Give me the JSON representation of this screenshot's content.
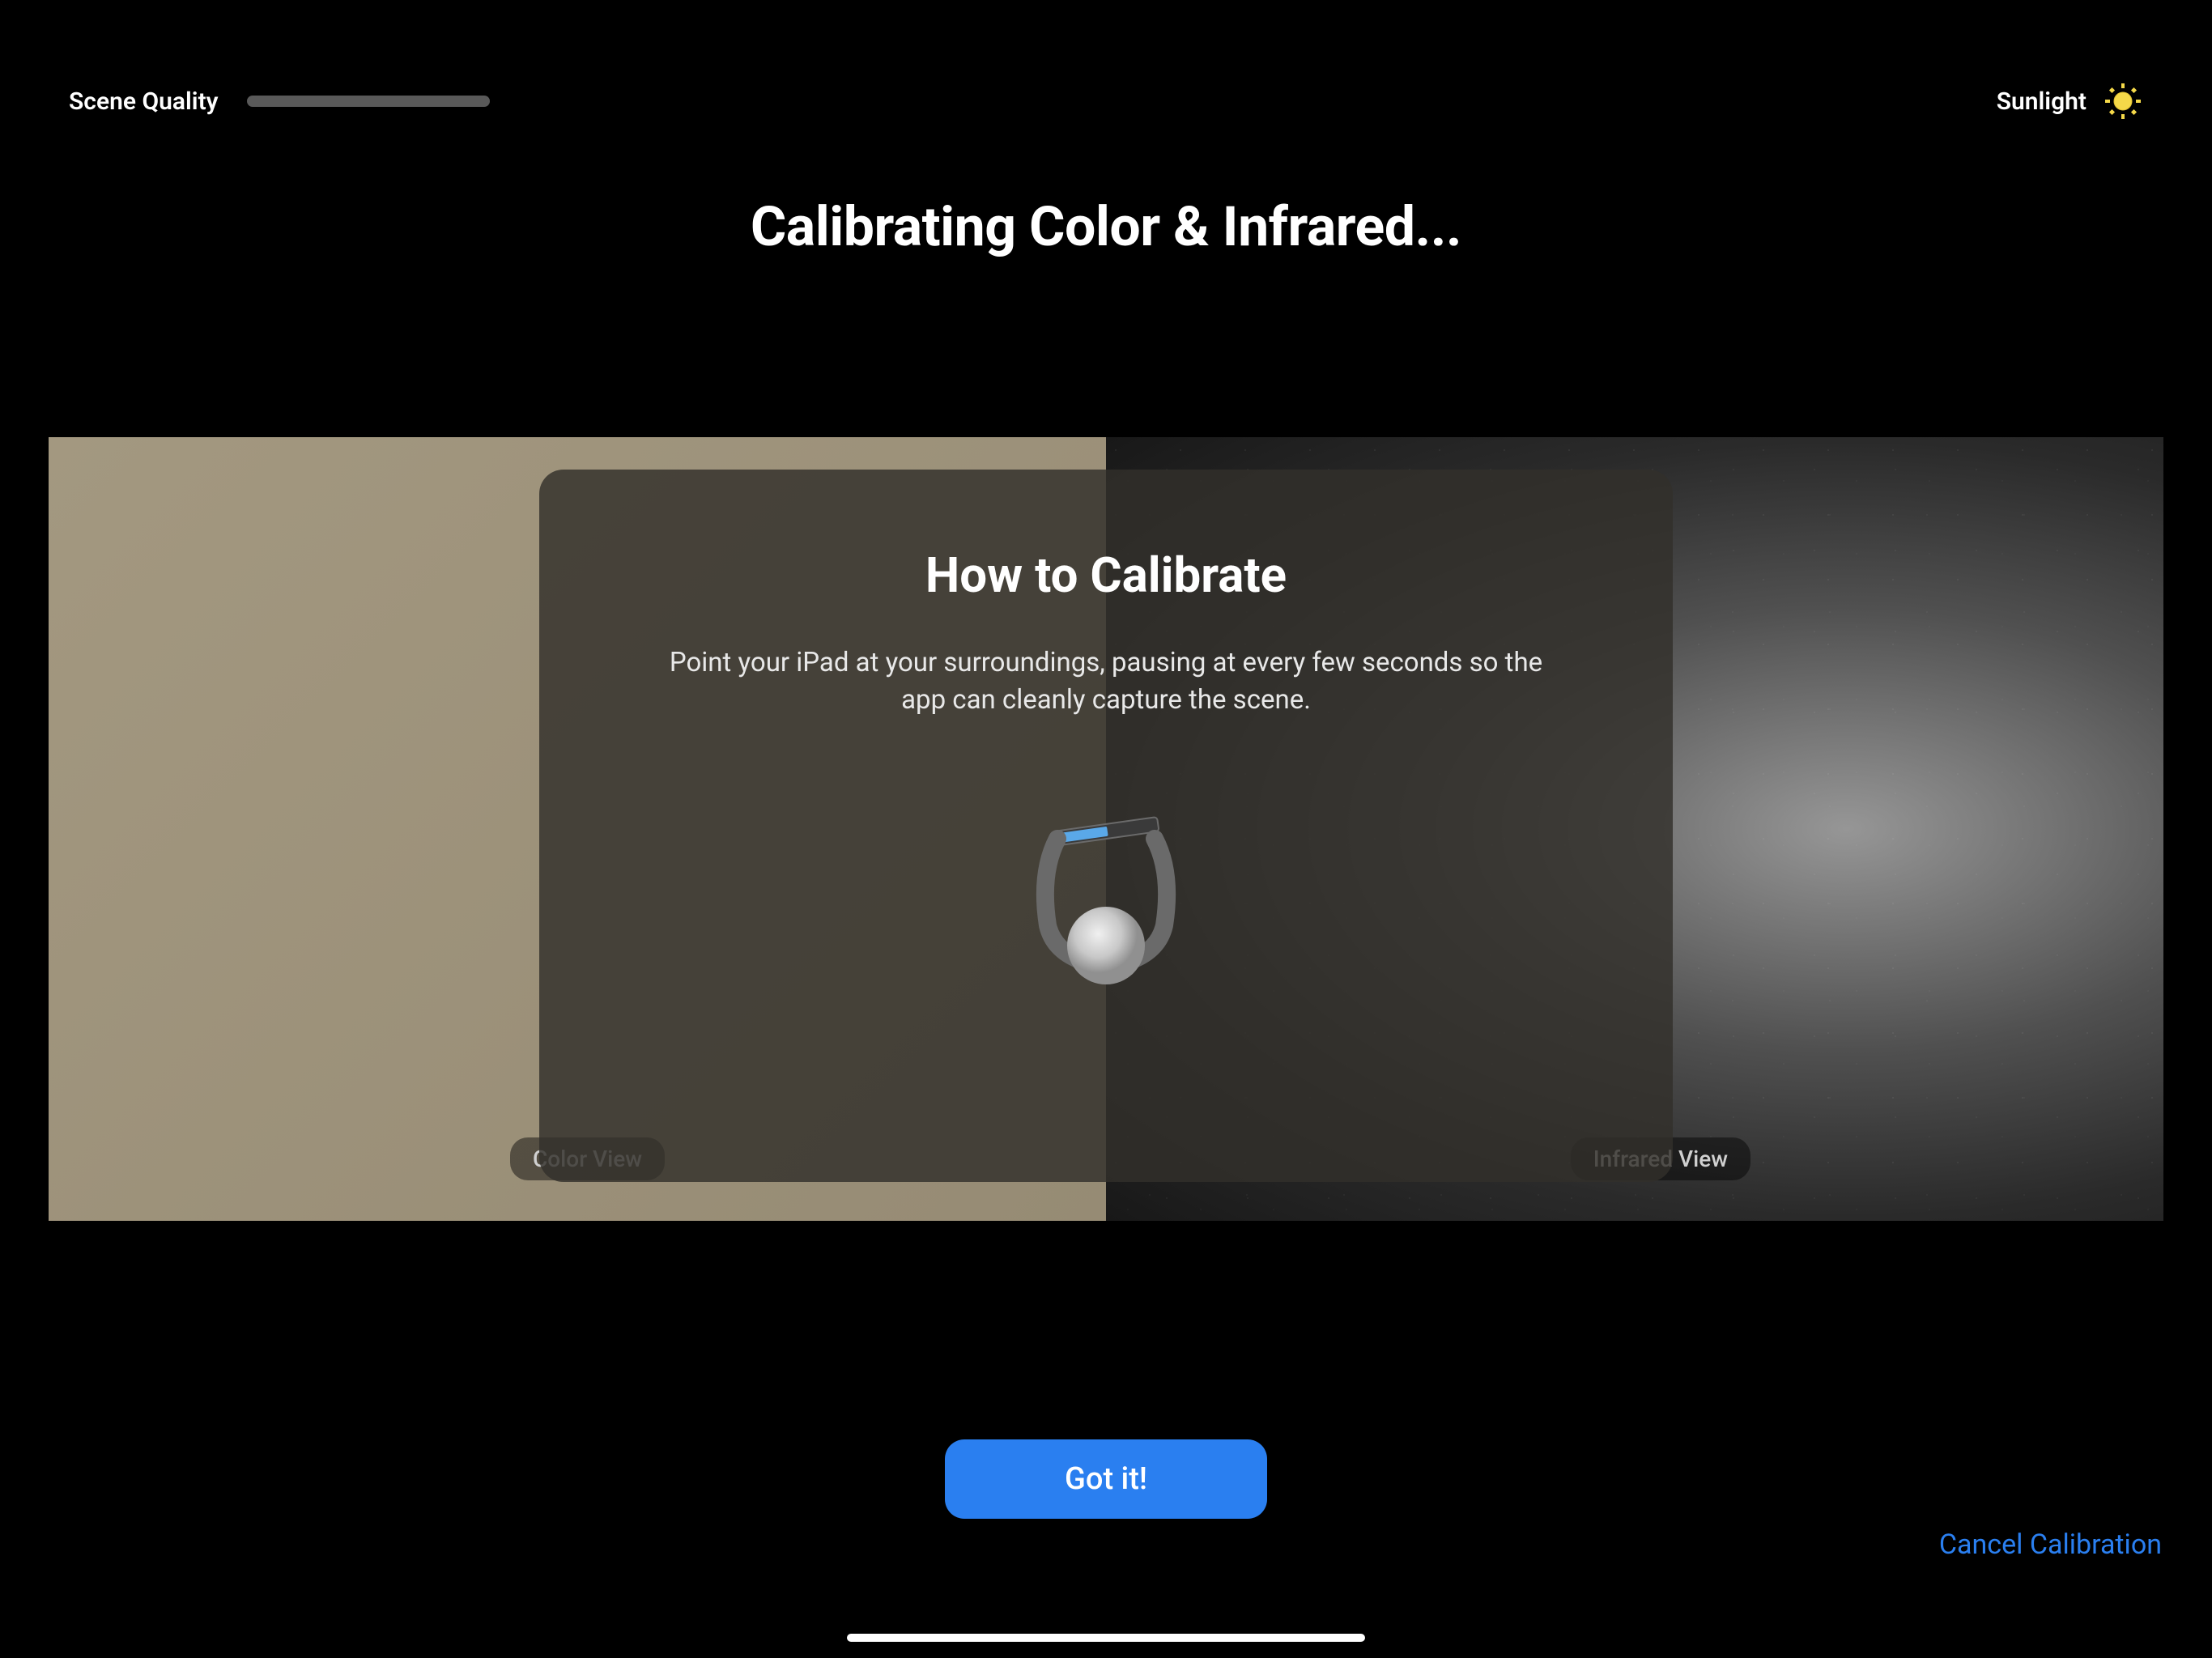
{
  "header": {
    "scene_quality_label": "Scene Quality",
    "sunlight_label": "Sunlight"
  },
  "page_title": "Calibrating Color & Infrared...",
  "views": {
    "color_label": "Color View",
    "infrared_label": "Infrared View"
  },
  "modal": {
    "title": "How to Calibrate",
    "body": "Point your iPad at your surroundings, pausing at every few seconds so the app can cleanly capture the scene."
  },
  "buttons": {
    "primary": "Got it!",
    "cancel": "Cancel Calibration"
  },
  "icons": {
    "sun": "sun-icon"
  },
  "colors": {
    "primary_blue": "#2a7ff0",
    "sun_yellow": "#f5d949"
  }
}
